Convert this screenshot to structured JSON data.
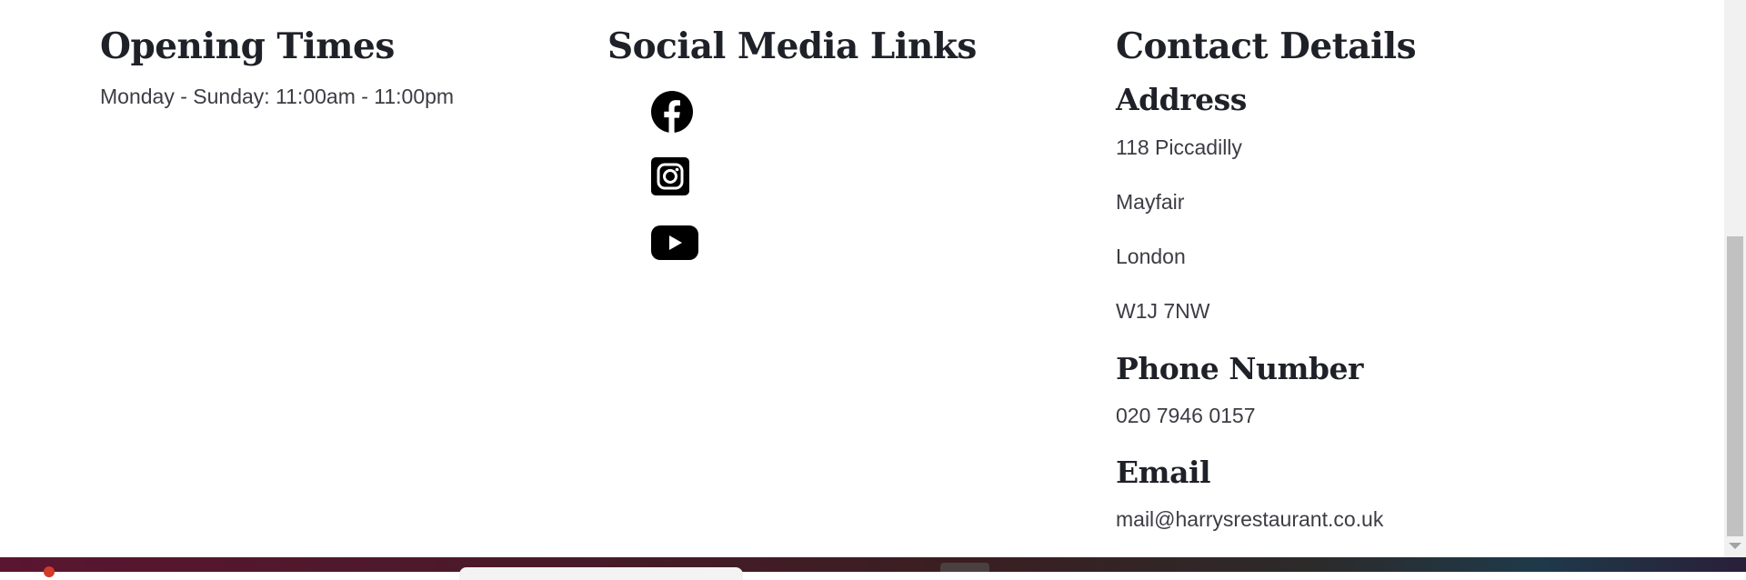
{
  "opening_times": {
    "heading": "Opening Times",
    "hours": "Monday - Sunday: 11:00am - 11:00pm"
  },
  "social": {
    "heading": "Social Media Links",
    "links": [
      {
        "icon": "facebook-icon"
      },
      {
        "icon": "instagram-icon"
      },
      {
        "icon": "youtube-icon"
      }
    ]
  },
  "contact": {
    "heading": "Contact Details",
    "address_heading": "Address",
    "address_lines": [
      "118 Piccadilly",
      "Mayfair",
      "London",
      "W1J 7NW"
    ],
    "phone_heading": "Phone Number",
    "phone": "020 7946 0157",
    "email_heading": "Email",
    "email": "mail@harrysrestaurant.co.uk"
  },
  "colors": {
    "heading": "#1f2128",
    "body_text": "#3c3c44",
    "icon": "#000000",
    "background": "#ffffff"
  }
}
